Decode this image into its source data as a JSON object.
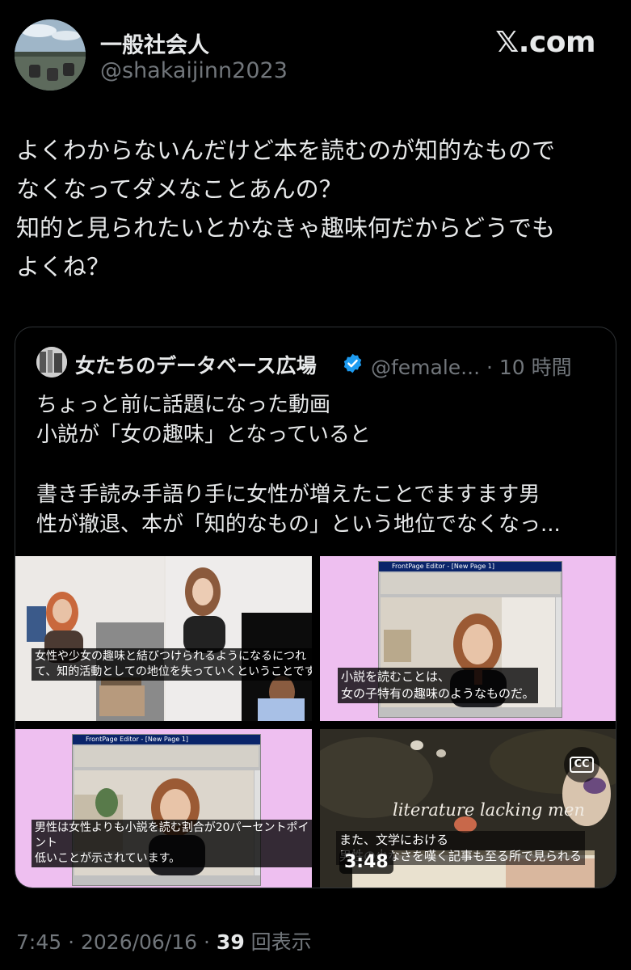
{
  "header": {
    "display_name": "一般社会人",
    "handle": "@shakaijinn2023",
    "brand": "𝕏.com"
  },
  "post": {
    "lines": [
      "よくわからないんだけど本を読むのが知的なもので",
      "なくなってダメなことあんの？",
      "知的と見られたいとかなきゃ趣味何だからどうでも",
      "よくね？"
    ]
  },
  "quoted": {
    "display_name": "女たちのデータベース広場",
    "handle_time": "@female... · 10 時間",
    "lines": [
      "ちょっと前に話題になった動画",
      "小説が「女の趣味」となっていると",
      "",
      "書き手読み手語り手に女性が増えたことでますます男",
      "性が撤退、本が「知的なもの」という地位でなくなっ..."
    ],
    "media": {
      "tile1_caption": [
        "女性や少女の趣味と結びつけられるようになるにつれ",
        "て、知的活動としての地位を失っていくということです"
      ],
      "tile2_caption": [
        "小説を読むことは、",
        "女の子特有の趣味のようなものだ。"
      ],
      "tile3_caption": [
        "男性は女性よりも小説を読む割合が20パーセントポイ",
        "ント",
        "低いことが示されています。"
      ],
      "tile4_overlay": "literature lacking men",
      "tile4_caption": [
        "また、文学における",
        "男性の少なさを嘆く記事も至る所で見られる"
      ],
      "window_title": "FrontPage Editor - [New Page 1]",
      "duration": "3:48",
      "cc_label": "CC"
    }
  },
  "meta": {
    "time_date": "7:45 · 2026/06/16 · ",
    "views": "39",
    "views_label": " 回表示"
  },
  "colors": {
    "background": "#000000",
    "text": "#e7e9ea",
    "muted": "#71767b",
    "verified": "#1d9bf0",
    "border": "#2f3336"
  }
}
